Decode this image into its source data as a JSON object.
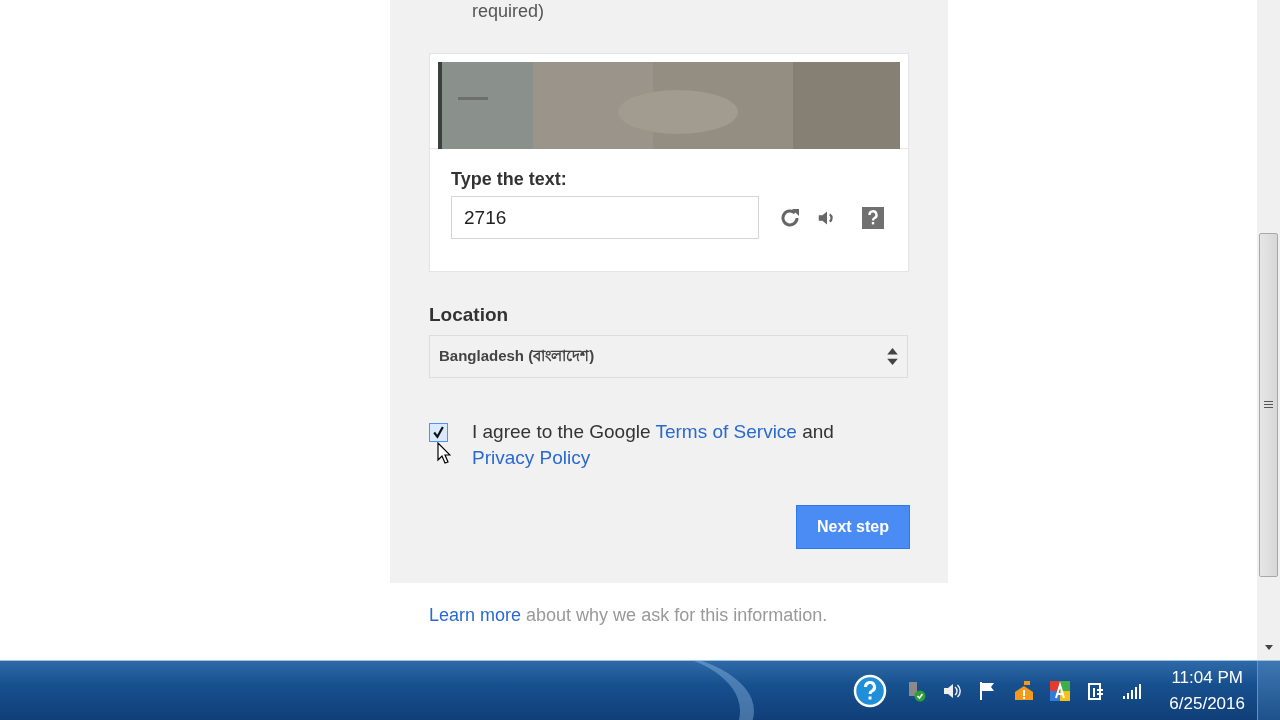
{
  "form": {
    "note": "required)",
    "captcha": {
      "label": "Type the text:",
      "value": "2716"
    },
    "location": {
      "label": "Location",
      "value": "Bangladesh (বাংলাদেশ)"
    },
    "agreement": {
      "checked": true,
      "text_before": "I agree to the Google ",
      "terms_link": "Terms of Service",
      "text_middle": " and ",
      "privacy_link": "Privacy Policy"
    },
    "next_button": "Next step"
  },
  "footer": {
    "link": "Learn more",
    "text": "about why we ask for this information."
  },
  "taskbar": {
    "time": "11:04 PM",
    "date": "6/25/2016"
  }
}
